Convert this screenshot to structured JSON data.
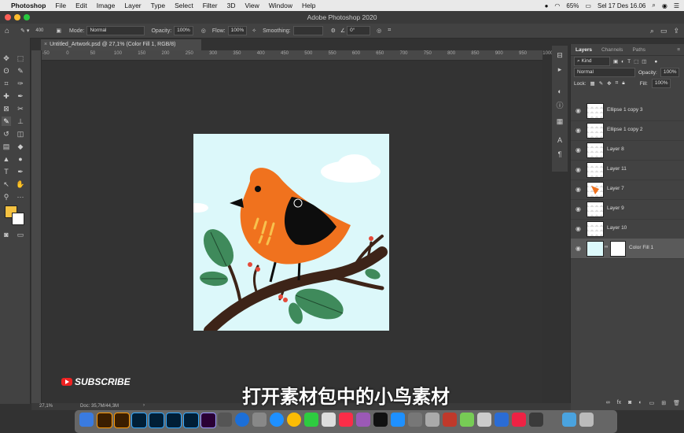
{
  "menubar": {
    "app_name": "Photoshop",
    "items": [
      "File",
      "Edit",
      "Image",
      "Layer",
      "Type",
      "Select",
      "Filter",
      "3D",
      "View",
      "Window",
      "Help"
    ],
    "battery": "65%",
    "datetime": "Sel 17 Des  16.06"
  },
  "window": {
    "title": "Adobe Photoshop 2020"
  },
  "options": {
    "brush_size": "400",
    "mode_label": "Mode:",
    "mode_value": "Normal",
    "opacity_label": "Opacity:",
    "opacity_value": "100%",
    "flow_label": "Flow:",
    "flow_value": "100%",
    "smoothing_label": "Smoothing:",
    "angle_value": "0°"
  },
  "document": {
    "tab_title": "Untitled_Artwork.psd @ 27,1% (Color Fill 1, RGB/8)",
    "zoom": "27,1%",
    "doc_info": "Doc: 35,7M/44,3M"
  },
  "ruler_ticks": [
    "-50",
    "0",
    "50",
    "100",
    "150",
    "200",
    "250",
    "300",
    "350",
    "400",
    "450",
    "500",
    "550",
    "600",
    "650",
    "700",
    "750",
    "800",
    "850",
    "900",
    "950",
    "1000"
  ],
  "layers_panel": {
    "tabs": [
      "Layers",
      "Channels",
      "Paths"
    ],
    "filter": "Kind",
    "blend_mode": "Normal",
    "opacity_label": "Opacity:",
    "opacity_value": "100%",
    "lock_label": "Lock:",
    "fill_label": "Fill:",
    "fill_value": "100%",
    "layers": [
      {
        "name": "Ellipse 1 copy 3"
      },
      {
        "name": "Ellipse 1 copy 2"
      },
      {
        "name": "Layer 8"
      },
      {
        "name": "Layer 11"
      },
      {
        "name": "Layer 7"
      },
      {
        "name": "Layer 9"
      },
      {
        "name": "Layer 10"
      },
      {
        "name": "Color Fill 1"
      }
    ]
  },
  "overlay": {
    "subscribe": "SUBSCRIBE",
    "subtitle": "打开素材包中的小鸟素材"
  },
  "colors": {
    "foreground": "#f5c242",
    "background": "#ffffff",
    "artwork_bg": "#dcf8fa",
    "bird_orange": "#f0721e",
    "bird_wing": "#0d0d0d",
    "leaf_green": "#3f8a5b",
    "branch": "#3d2418"
  }
}
